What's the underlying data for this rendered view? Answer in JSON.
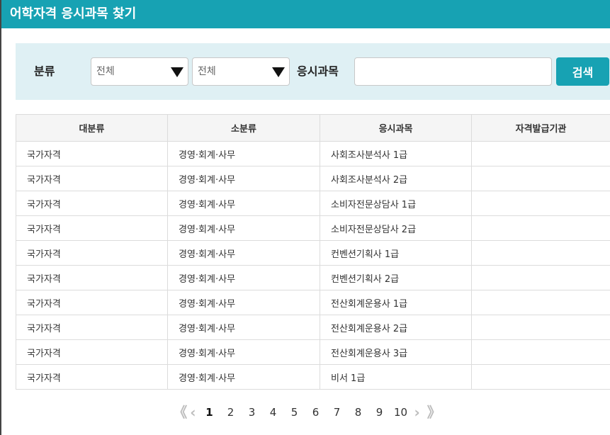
{
  "window": {
    "title": "어학자격 응시과목 찾기"
  },
  "filter": {
    "category_label": "분류",
    "major_select_value": "전체",
    "minor_select_value": "전체",
    "subject_label": "응시과목",
    "subject_input_value": "",
    "search_button": "검색"
  },
  "table": {
    "headers": [
      "대분류",
      "소분류",
      "응시과목",
      "자격발급기관"
    ],
    "rows": [
      [
        "국가자격",
        "경영·회계·사무",
        "사회조사분석사 1급",
        ""
      ],
      [
        "국가자격",
        "경영·회계·사무",
        "사회조사분석사 2급",
        ""
      ],
      [
        "국가자격",
        "경영·회계·사무",
        "소비자전문상담사 1급",
        ""
      ],
      [
        "국가자격",
        "경영·회계·사무",
        "소비자전문상담사 2급",
        ""
      ],
      [
        "국가자격",
        "경영·회계·사무",
        "컨벤션기획사 1급",
        ""
      ],
      [
        "국가자격",
        "경영·회계·사무",
        "컨벤션기획사 2급",
        ""
      ],
      [
        "국가자격",
        "경영·회계·사무",
        "전산회계운용사 1급",
        ""
      ],
      [
        "국가자격",
        "경영·회계·사무",
        "전산회계운용사 2급",
        ""
      ],
      [
        "국가자격",
        "경영·회계·사무",
        "전산회계운용사 3급",
        ""
      ],
      [
        "국가자격",
        "경영·회계·사무",
        "비서 1급",
        ""
      ]
    ]
  },
  "pagination": {
    "first": "《",
    "prev": "‹",
    "pages": [
      "1",
      "2",
      "3",
      "4",
      "5",
      "6",
      "7",
      "8",
      "9",
      "10"
    ],
    "current": "1",
    "next": "›",
    "last": "》"
  }
}
